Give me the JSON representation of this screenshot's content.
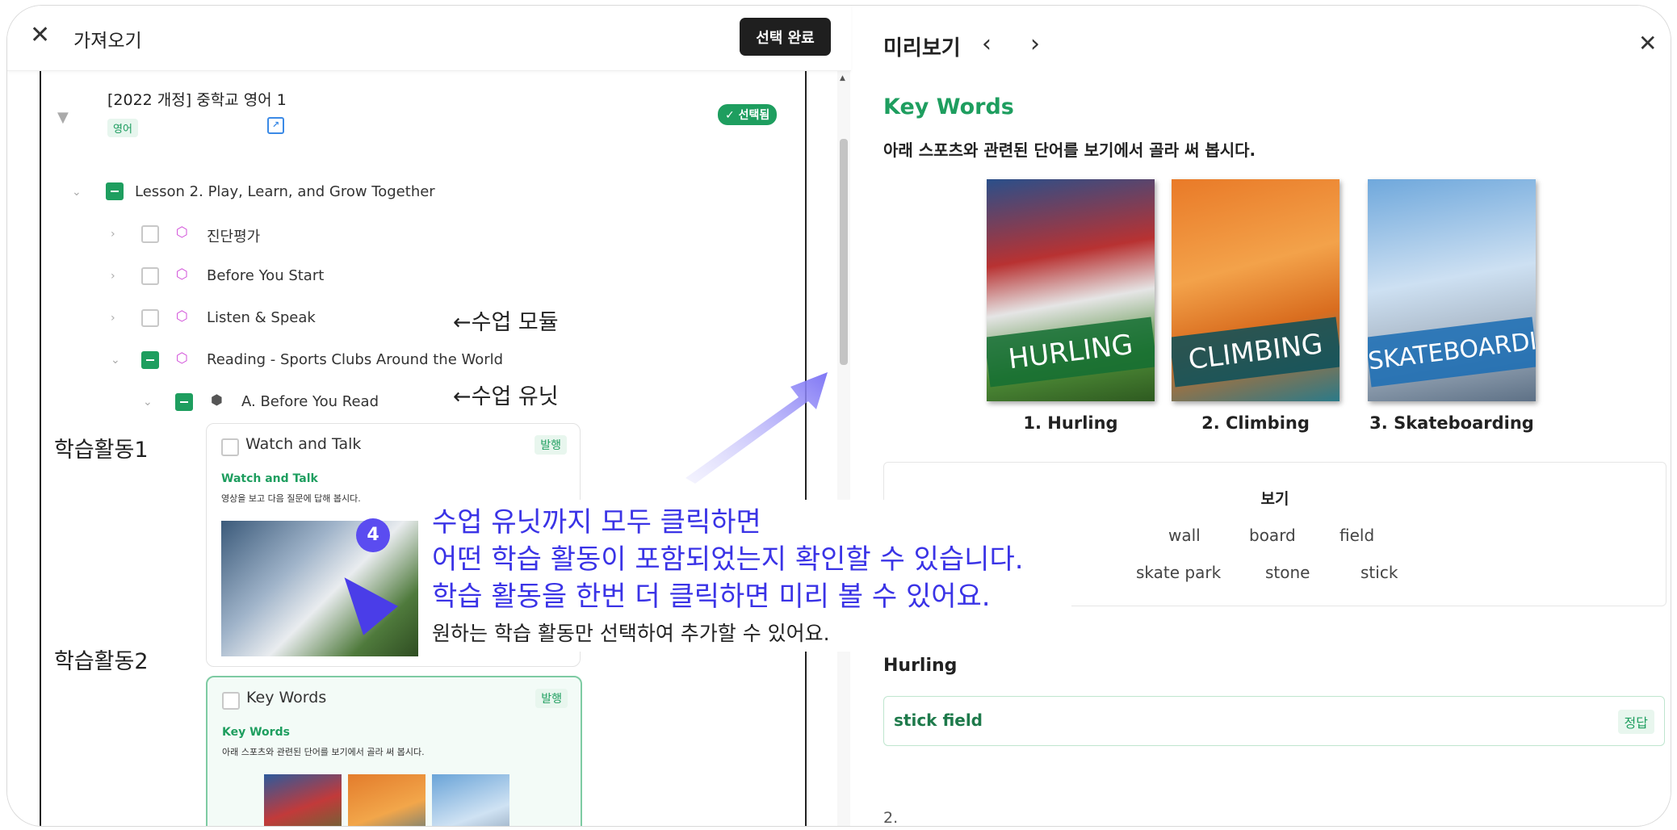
{
  "header": {
    "title": "가져오기",
    "done_button": "선택 완료"
  },
  "book": {
    "title": "[2022 개정] 중학교 영어 1",
    "subject": "영어",
    "selected_badge": "✓ 선택됨"
  },
  "tree": {
    "lesson": "Lesson 2. Play, Learn, and Grow Together",
    "modules": [
      {
        "label": "진단평가"
      },
      {
        "label": "Before You Start"
      },
      {
        "label": "Listen & Speak"
      },
      {
        "label": "Reading - Sports Clubs Around the World"
      }
    ],
    "unit": "A. Before You Read"
  },
  "annotations": {
    "module": "←수업 모듈",
    "unit": "←수업 유닛",
    "activity1": "학습활동1",
    "activity2": "학습활동2",
    "step_number": "4"
  },
  "cards": [
    {
      "title": "Watch and Talk",
      "badge": "발행",
      "heading": "Watch and Talk",
      "sub": "영상을 보고 다음 질문에 답해 봅시다."
    },
    {
      "title": "Key Words",
      "badge": "발행",
      "heading": "Key Words",
      "sub": "아래 스포츠와 관련된 단어를 보기에서 골라 써 봅시다."
    }
  ],
  "overlay": {
    "line1": "수업 유닛까지 모두 클릭하면",
    "line2": "어떤 학습 활동이 포함되었는지 확인할 수 있습니다.",
    "line3": "학습 활동을 한번 더 클릭하면 미리 볼 수 있어요.",
    "line4": "원하는 학습 활동만 선택하여 추가할 수 있어요."
  },
  "preview": {
    "title": "미리보기",
    "heading": "Key Words",
    "instruction": "아래 스포츠와 관련된 단어를 보기에서 골라 써 봅시다.",
    "images": [
      {
        "band": "HURLING",
        "caption": "1. Hurling"
      },
      {
        "band": "CLIMBING",
        "caption": "2. Climbing"
      },
      {
        "band": "SKATEBOARDING",
        "caption": "3. Skateboarding"
      }
    ],
    "bogi_title": "보기",
    "words": [
      "wall",
      "board",
      "field",
      "skate park",
      "stone",
      "stick"
    ],
    "question_title": "Hurling",
    "answer": "stick field",
    "answer_badge": "정답",
    "next_item": "2."
  },
  "colors": {
    "accent_green": "#1e9e5f",
    "overlay_blue": "#3a33e6",
    "dark": "#1f1f1f"
  }
}
